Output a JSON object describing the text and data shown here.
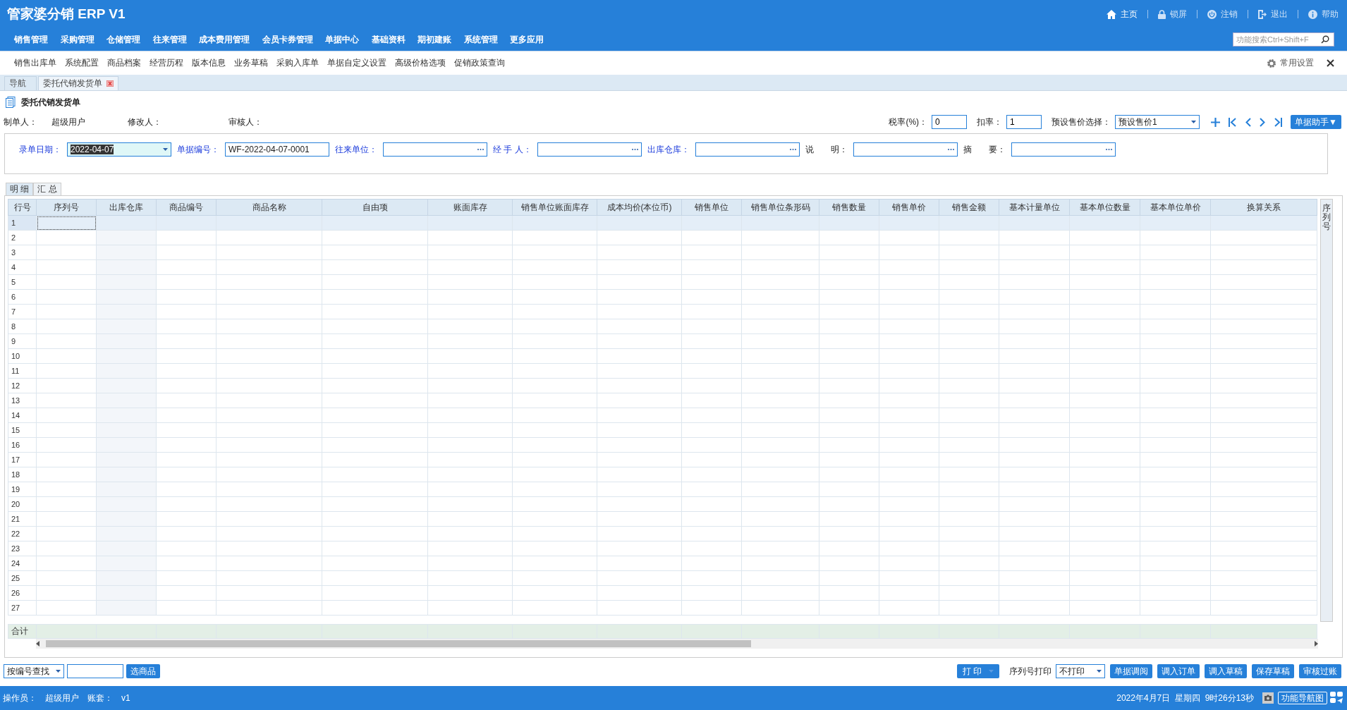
{
  "app": {
    "title": "管家婆分销 ERP V1"
  },
  "top_links": [
    {
      "label": "主页",
      "kind": "home"
    },
    {
      "label": "锁屏",
      "kind": "lock"
    },
    {
      "label": "注销",
      "kind": "power"
    },
    {
      "label": "退出",
      "kind": "exit"
    },
    {
      "label": "帮助",
      "kind": "info"
    }
  ],
  "main_menu": [
    "销售管理",
    "采购管理",
    "仓储管理",
    "往来管理",
    "成本费用管理",
    "会员卡券管理",
    "单据中心",
    "基础资料",
    "期初建账",
    "系统管理",
    "更多应用"
  ],
  "search": {
    "placeholder": "功能搜索Ctrl+Shift+F"
  },
  "quick_links": [
    "销售出库单",
    "系统配置",
    "商品档案",
    "经营历程",
    "版本信息",
    "业务草稿",
    "采购入库单",
    "单据自定义设置",
    "高级价格选项",
    "促销政策查询"
  ],
  "settings": {
    "label": "常用设置"
  },
  "tabs": [
    {
      "label": "导航",
      "selected": false,
      "closable": false
    },
    {
      "label": "委托代销发货单",
      "selected": true,
      "closable": true
    }
  ],
  "document": {
    "title": "委托代销发货单",
    "meta": [
      {
        "label": "制单人：",
        "value": "超级用户"
      },
      {
        "label": "修改人："
      },
      {
        "label": "审核人："
      }
    ],
    "tax_rate": {
      "label": "税率(%)：",
      "value": "0"
    },
    "discount": {
      "label": "扣率：",
      "value": "1"
    },
    "price_preset": {
      "label": "预设售价选择：",
      "value": "预设售价1"
    },
    "helper_button": "单据助手▼",
    "fields": [
      {
        "label": "录单日期：",
        "kind": "date",
        "value": "2022-04-07",
        "required": true,
        "highlighted": true
      },
      {
        "label": "单据编号：",
        "kind": "text",
        "value": "WF-2022-04-07-0001",
        "required": true,
        "highlighted": false
      },
      {
        "label": "往来单位：",
        "kind": "lookup",
        "required": true,
        "highlighted": false
      },
      {
        "label": "经 手 人：",
        "kind": "lookup",
        "required": true,
        "highlighted": false
      },
      {
        "label": "出库仓库：",
        "kind": "lookup",
        "required": true,
        "highlighted": false
      },
      {
        "label": "说　　明：",
        "kind": "lookup",
        "required": false,
        "highlighted": false
      },
      {
        "label": "摘　　要：",
        "kind": "lookup",
        "required": false,
        "highlighted": false
      }
    ]
  },
  "grid": {
    "tabs": [
      {
        "label": "明 细",
        "selected": true
      },
      {
        "label": "汇 总",
        "selected": false
      }
    ],
    "columns": [
      "行号",
      "序列号",
      "出库仓库",
      "商品编号",
      "商品名称",
      "自由项",
      "账面库存",
      "销售单位账面库存",
      "成本均价(本位币)",
      "销售单位",
      "销售单位条形码",
      "销售数量",
      "销售单价",
      "销售金额",
      "基本计量单位",
      "基本单位数量",
      "基本单位单价",
      "换算关系"
    ],
    "rows": [
      {
        "row_number": "1",
        "selected": true
      },
      {
        "row_number": "2",
        "selected": false
      },
      {
        "row_number": "3",
        "selected": false
      },
      {
        "row_number": "4",
        "selected": false
      },
      {
        "row_number": "5",
        "selected": false
      },
      {
        "row_number": "6",
        "selected": false
      },
      {
        "row_number": "7",
        "selected": false
      },
      {
        "row_number": "8",
        "selected": false
      },
      {
        "row_number": "9",
        "selected": false
      },
      {
        "row_number": "10",
        "selected": false
      },
      {
        "row_number": "11",
        "selected": false
      },
      {
        "row_number": "12",
        "selected": false
      },
      {
        "row_number": "13",
        "selected": false
      },
      {
        "row_number": "14",
        "selected": false
      },
      {
        "row_number": "15",
        "selected": false
      },
      {
        "row_number": "16",
        "selected": false
      },
      {
        "row_number": "17",
        "selected": false
      },
      {
        "row_number": "18",
        "selected": false
      },
      {
        "row_number": "19",
        "selected": false
      },
      {
        "row_number": "20",
        "selected": false
      },
      {
        "row_number": "21",
        "selected": false
      },
      {
        "row_number": "22",
        "selected": false
      },
      {
        "row_number": "23",
        "selected": false
      },
      {
        "row_number": "24",
        "selected": false
      },
      {
        "row_number": "25",
        "selected": false
      },
      {
        "row_number": "26",
        "selected": false
      },
      {
        "row_number": "27",
        "selected": false
      }
    ],
    "total_label": "合计",
    "side_column": "序列号"
  },
  "actions": {
    "search_mode": "按编号查找",
    "pick_button": "选商品",
    "print_button": "打 印",
    "serial_print_label": "序列号打印",
    "serial_print_value": "不打印",
    "buttons": [
      "单据调阅",
      "调入订单",
      "调入草稿",
      "保存草稿",
      "审核过账"
    ]
  },
  "status_bar": {
    "operator_label": "操作员：",
    "operator": "超级用户",
    "account_label": "账套：",
    "account": "v1",
    "datetime": "2022年4月7日  星期四  9时26分13秒",
    "nav_button": "功能导航图"
  }
}
